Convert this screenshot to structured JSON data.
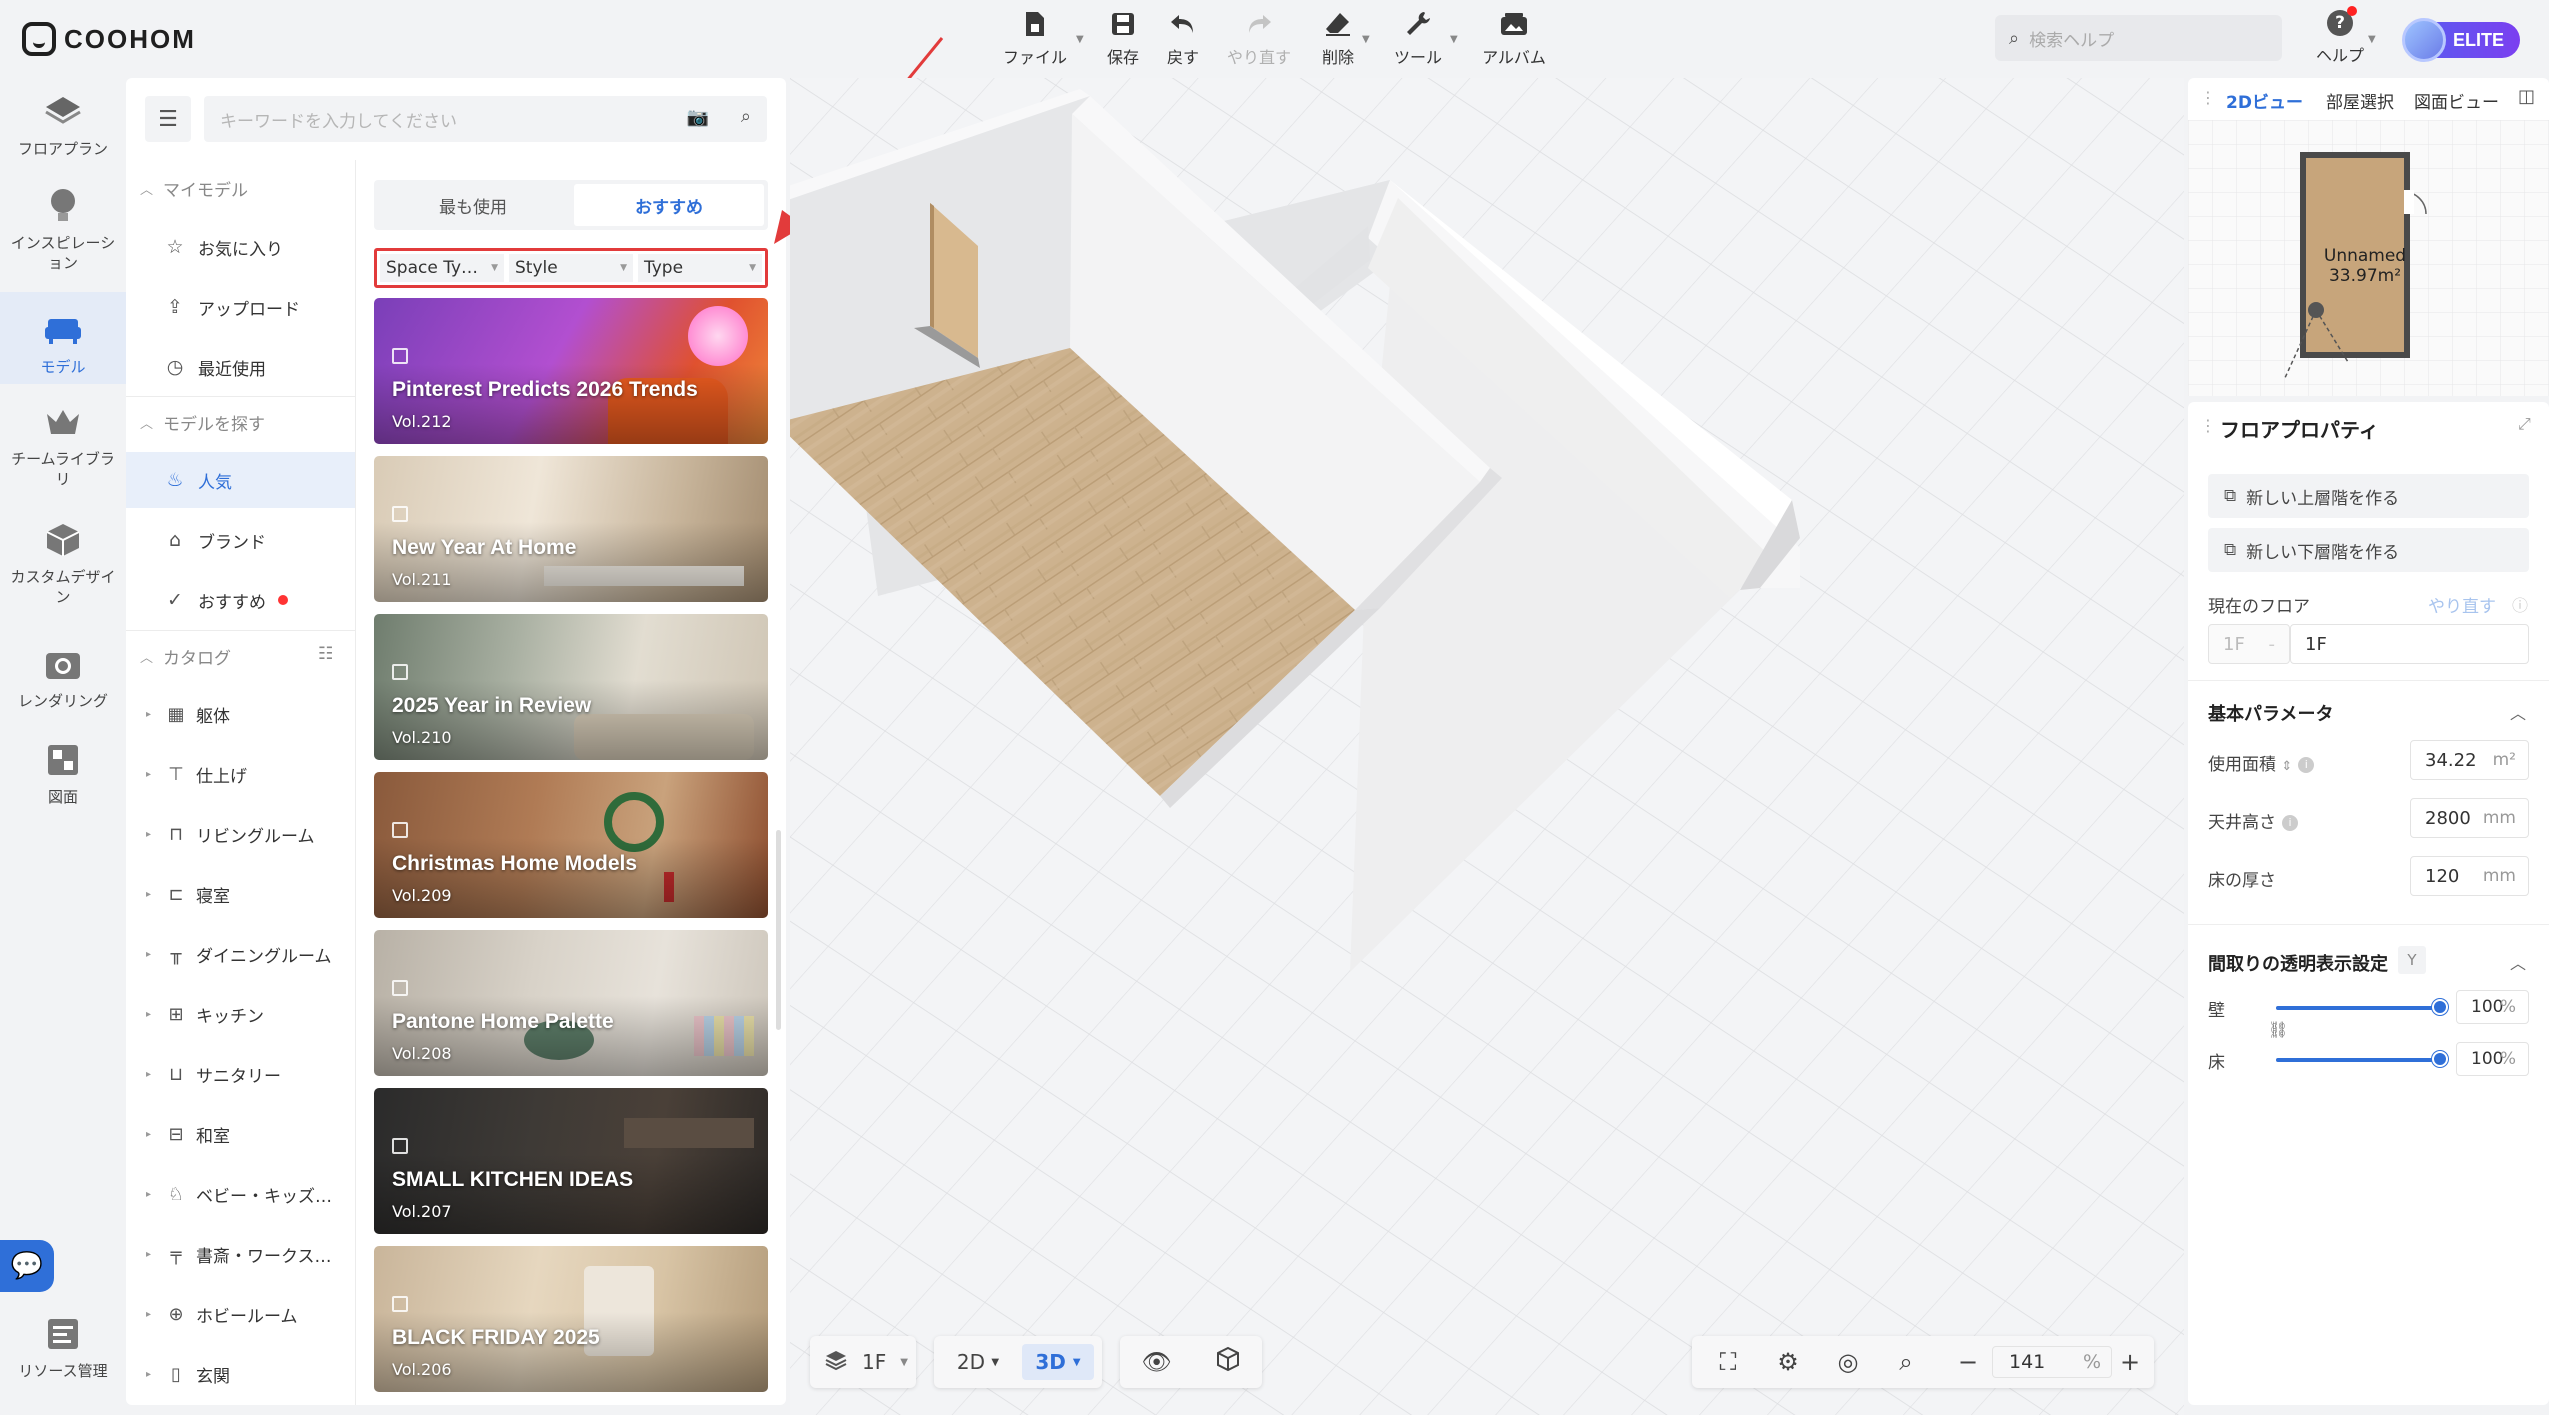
{
  "app": {
    "logo_text": "COOHOM"
  },
  "toolbar": {
    "items": [
      {
        "label": "ファイル",
        "icon": "file-icon"
      },
      {
        "label": "保存",
        "icon": "save-icon"
      },
      {
        "label": "戻す",
        "icon": "undo-icon"
      },
      {
        "label": "やり直す",
        "icon": "redo-icon"
      },
      {
        "label": "削除",
        "icon": "eraser-icon"
      },
      {
        "label": "ツール",
        "icon": "wrench-icon"
      },
      {
        "label": "アルバム",
        "icon": "album-icon"
      }
    ],
    "help_search_placeholder": "検索ヘルプ",
    "help_label": "ヘルプ",
    "plan_badge": "ELITE"
  },
  "rail": [
    {
      "label": "フロアプラン",
      "icon": "floorplan-icon"
    },
    {
      "label": "インスピレーション",
      "icon": "bulb-icon"
    },
    {
      "label": "モデル",
      "icon": "sofa-icon"
    },
    {
      "label": "チームライブラリ",
      "icon": "crown-icon"
    },
    {
      "label": "カスタムデザイン",
      "icon": "box-icon"
    },
    {
      "label": "レンダリング",
      "icon": "camera-icon"
    },
    {
      "label": "図面",
      "icon": "drawing-icon"
    },
    {
      "label": "リソース管理",
      "icon": "resource-icon"
    }
  ],
  "catalog": {
    "search_placeholder": "キーワードを入力してください",
    "my_models": {
      "heading": "マイモデル",
      "items": [
        "お気に入り",
        "アップロード",
        "最近使用"
      ]
    },
    "find_models": {
      "heading": "モデルを探す",
      "items": [
        "人気",
        "ブランド",
        "おすすめ"
      ]
    },
    "catalog_section": {
      "heading": "カタログ",
      "items": [
        "躯体",
        "仕上げ",
        "リビングルーム",
        "寝室",
        "ダイニングルーム",
        "キッチン",
        "サニタリー",
        "和室",
        "ベビー・キッズ…",
        "書斎・ワークス…",
        "ホビールーム",
        "玄関"
      ]
    },
    "tabs": [
      "最も使用",
      "おすすめ"
    ],
    "filters": [
      "Space Ty…",
      "Style",
      "Type"
    ],
    "cards": [
      {
        "title": "Pinterest Predicts 2026 Trends",
        "vol": "Vol.212"
      },
      {
        "title": "New Year At Home",
        "vol": "Vol.211"
      },
      {
        "title": "2025 Year in Review",
        "vol": "Vol.210"
      },
      {
        "title": "Christmas Home Models",
        "vol": "Vol.209"
      },
      {
        "title": "Pantone Home Palette",
        "vol": "Vol.208"
      },
      {
        "title": "SMALL KITCHEN IDEAS",
        "vol": "Vol.207"
      },
      {
        "title": "BLACK FRIDAY 2025",
        "vol": "Vol.206"
      }
    ]
  },
  "viewport": {
    "floor_label": "1F",
    "view_2d": "2D",
    "view_3d": "3D",
    "zoom_value": "141",
    "zoom_unit": "%"
  },
  "right_panel": {
    "tabs": [
      "2Dビュー",
      "部屋選択",
      "図面ビュー"
    ],
    "room_name": "Unnamed",
    "room_area": "33.97m²",
    "floor_props_title": "フロアプロパティ",
    "new_upper_floor": "新しい上層階を作る",
    "new_lower_floor": "新しい下層階を作る",
    "current_floor_label": "現在のフロア",
    "redo_link": "やり直す",
    "current_floor_prefix": "1F",
    "current_floor_value": "1F",
    "basic_params_title": "基本パラメータ",
    "usable_area_label": "使用面積",
    "usable_area_value": "34.22",
    "usable_area_unit": "m²",
    "ceiling_height_label": "天井高さ",
    "ceiling_height_value": "2800",
    "ceiling_height_unit": "mm",
    "floor_thickness_label": "床の厚さ",
    "floor_thickness_value": "120",
    "floor_thickness_unit": "mm",
    "transparency_title": "間取りの透明表示設定",
    "transparency_toggle": "Y",
    "wall_label": "壁",
    "wall_value": "100",
    "floor_label": "床",
    "floor_value": "100",
    "percent_unit": "%",
    "wall_opacity": 1.0,
    "floor_opacity": 1.0
  },
  "colors": {
    "accent": "#2f6fd8",
    "highlight_border": "#e23b3b",
    "elite_gradient_start": "#5a5cf0",
    "elite_gradient_end": "#7b3ff0"
  }
}
